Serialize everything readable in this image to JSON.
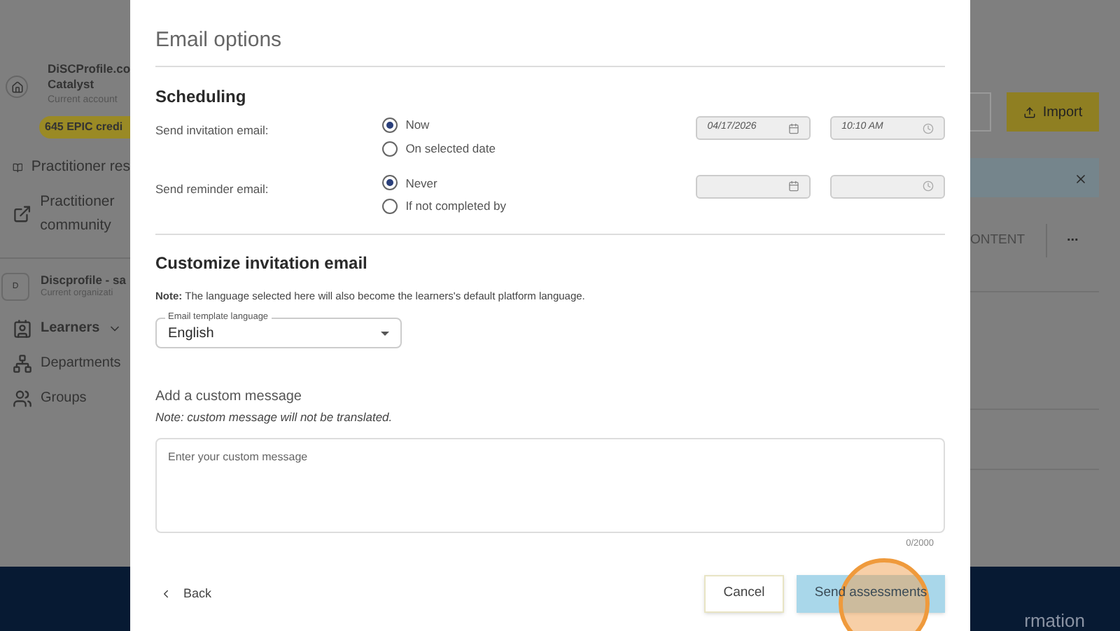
{
  "sidebar": {
    "account": {
      "name": "DiSCProfile.co",
      "plan": "Catalyst",
      "caption": "Current account"
    },
    "credits": "645 EPIC credi",
    "links": [
      {
        "label": "Practitioner res",
        "kind": "resource"
      },
      {
        "label": "Practitioner community",
        "kind": "external"
      }
    ],
    "organization": {
      "initial": "D",
      "name": "Discprofile - sa",
      "caption": "Current organizati"
    },
    "nav": [
      {
        "label": "Learners",
        "kind": "learners",
        "expanded": true
      },
      {
        "label": "Departments",
        "kind": "departments"
      },
      {
        "label": "Groups",
        "kind": "groups"
      }
    ]
  },
  "background": {
    "import_button": "Import",
    "tab_label": "ONTENT",
    "more": "...",
    "footer_text": "rmation"
  },
  "modal": {
    "title": "Email options",
    "scheduling": {
      "title": "Scheduling",
      "rows": [
        {
          "label": "Send invitation email:",
          "options": [
            {
              "label": "Now",
              "selected": true
            },
            {
              "label": "On selected date",
              "selected": false
            }
          ],
          "date": "04/17/2026",
          "time": "10:10 AM"
        },
        {
          "label": "Send reminder email:",
          "options": [
            {
              "label": "Never",
              "selected": true
            },
            {
              "label": "If not completed by",
              "selected": false
            }
          ]
        }
      ]
    },
    "customize": {
      "title": "Customize invitation email",
      "note": "**Note:** The language selected here will also become the learners's default platform language.",
      "language": {
        "label": "Email template language",
        "value": "English"
      },
      "message_title": "Add a custom message",
      "message_note": "Note: custom message will not be translated.",
      "message": {
        "placeholder": "Enter your custom message"
      },
      "counter": "0/2000"
    },
    "footer": {
      "back": "Back",
      "cancel": "Cancel",
      "send": "Send assessments"
    }
  }
}
